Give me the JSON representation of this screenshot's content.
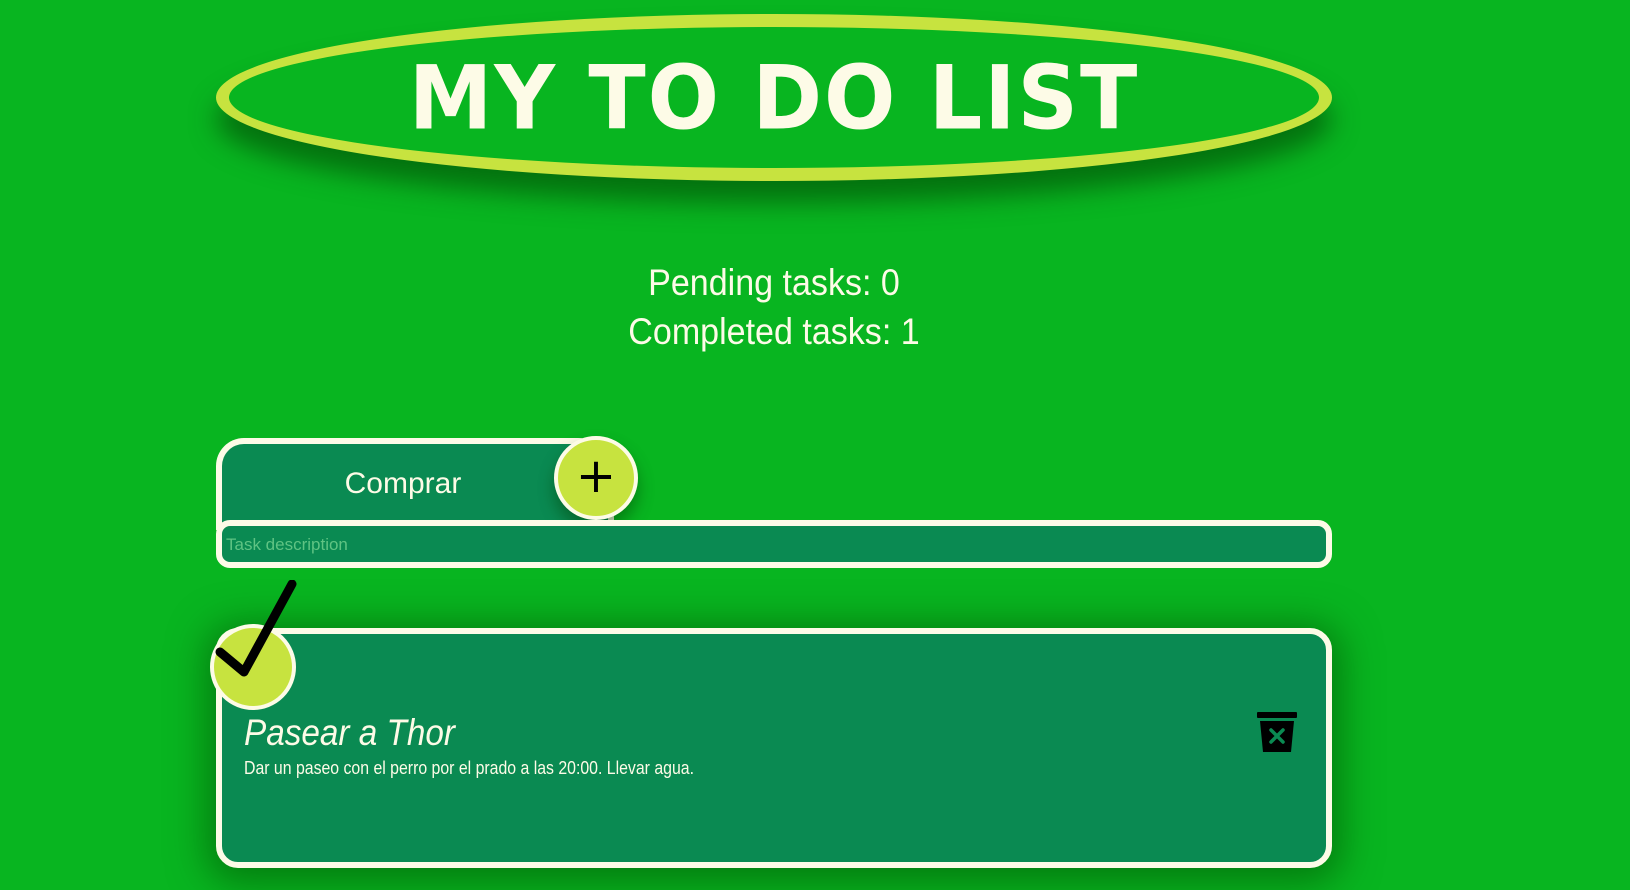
{
  "header": {
    "title": "MY TO DO LIST"
  },
  "counters": {
    "pending": "Pending tasks: 0",
    "completed": "Completed tasks: 1"
  },
  "form": {
    "title_value": "Comprar",
    "add_label": "+",
    "description_placeholder": "Task description",
    "description_value": ""
  },
  "tasks": [
    {
      "title": "Pasear a Thor",
      "description": "Dar un paseo con el perro por el prado a las 20:00. Llevar agua.",
      "completed": true
    }
  ],
  "colors": {
    "background": "#08b520",
    "accent": "#c7e33f",
    "card": "#0a8a52",
    "text": "#fdfbe7"
  },
  "icons": {
    "add": "plus-icon",
    "done": "checkmark-icon",
    "delete": "trash-icon"
  }
}
